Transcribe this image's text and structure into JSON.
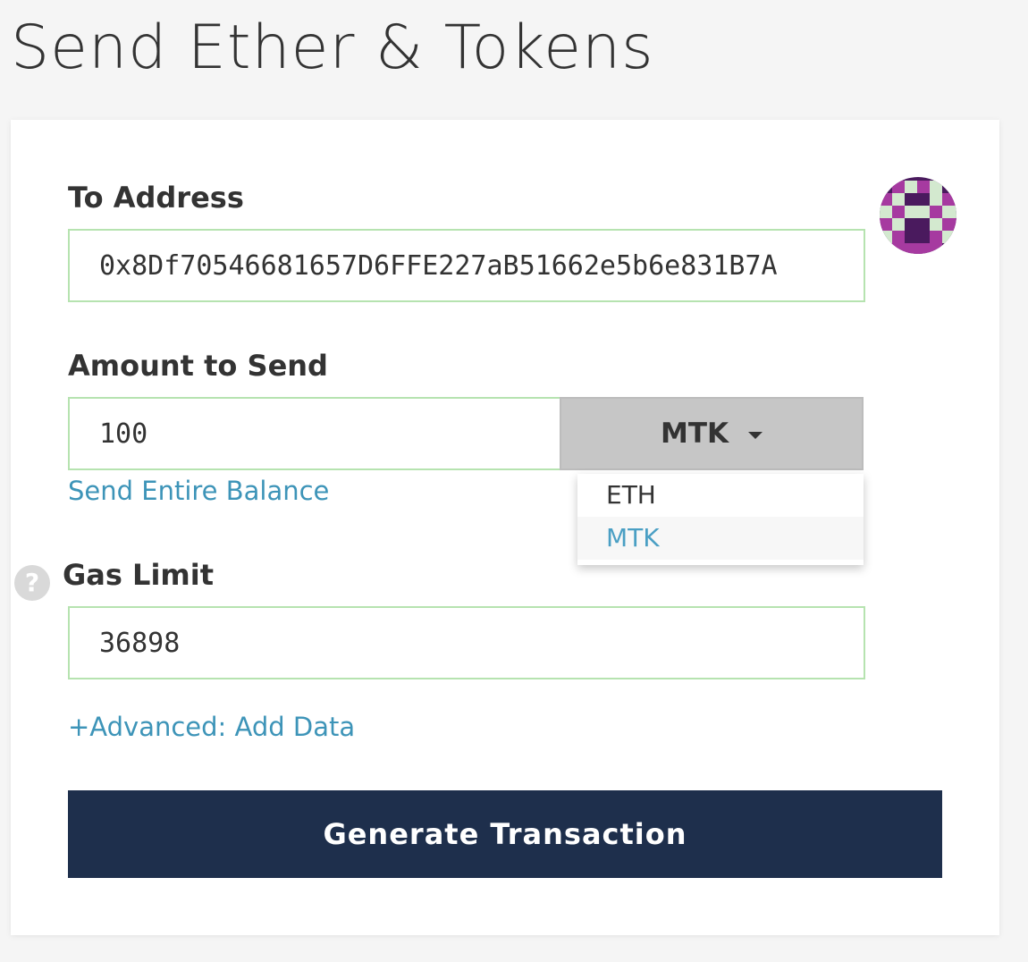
{
  "page": {
    "title": "Send Ether & Tokens"
  },
  "to_address": {
    "label": "To Address",
    "value": "0x8Df70546681657D6FFE227aB51662e5b6e831B7A"
  },
  "amount": {
    "label": "Amount to Send",
    "value": "100",
    "send_entire_balance": "Send Entire Balance"
  },
  "token_dropdown": {
    "selected": "MTK",
    "options": [
      "ETH",
      "MTK"
    ],
    "caret_icon": "caret-down-icon"
  },
  "gas": {
    "label": "Gas Limit",
    "value": "36898",
    "help_symbol": "?",
    "help_icon": "question-circle-icon"
  },
  "advanced": {
    "label": "+Advanced: Add Data"
  },
  "generate": {
    "label": "Generate Transaction"
  },
  "identicon": {
    "icon": "address-identicon-icon",
    "colors": {
      "dark": "#4a1a5e",
      "magenta": "#a63aa0",
      "light": "#d3e9cf"
    }
  },
  "colors": {
    "accent_link": "#3d94b8",
    "button_bg": "#1e2f4c",
    "field_border": "#b6e3b0"
  }
}
